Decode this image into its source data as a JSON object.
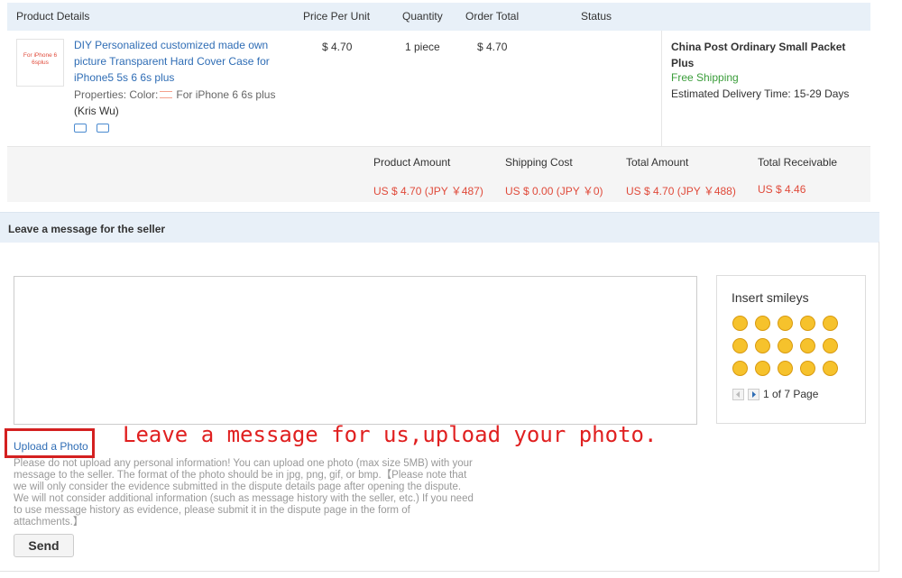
{
  "order_table": {
    "headers": [
      "Product Details",
      "Price Per Unit",
      "Quantity",
      "Order Total",
      "Status"
    ],
    "product": {
      "thumb_text": "For iPhone 6 6splus",
      "title": "DIY Personalized customized made own picture Transparent Hard Cover Case for iPhone5 5s 6 6s plus",
      "properties_label": "Properties: Color:",
      "properties_value": "For iPhone 6 6s plus",
      "properties_extra": "(Kris Wu)",
      "icons": [
        "snapshot-icon",
        "return-icon"
      ]
    },
    "price": "$ 4.70",
    "quantity": "1 piece",
    "order_total": "$ 4.70",
    "shipping": {
      "method": "China Post Ordinary Small Packet Plus",
      "cost_text": "Free Shipping",
      "estimate": "Estimated Delivery Time: 15-29 Days"
    }
  },
  "summary": {
    "labels": [
      "Product Amount",
      "Shipping Cost",
      "Total Amount",
      "Total Receivable"
    ],
    "values": [
      "US $ 4.70 (JPY ￥487)",
      "US $ 0.00 (JPY ￥0)",
      "US $ 4.70 (JPY ￥488)",
      "US $ 4.46"
    ]
  },
  "message": {
    "heading": "Leave a message for the seller",
    "upload_label": "Upload a Photo",
    "annotation": "Leave a message for us,upload your photo.",
    "notice": "Please do not upload any personal information! You can upload one photo (max size 5MB) with your message to the seller. The format of the photo should be in jpg, png, gif, or bmp.【Please note that we will only consider the evidence submitted in the dispute details page after opening the dispute. We will not consider additional information (such as message history with the seller, etc.) If you need to use message history as evidence, please submit it in the dispute page in the form of attachments.】",
    "send_label": "Send"
  },
  "smileys": {
    "title": "Insert smileys",
    "count": 15,
    "page_text": "1 of 7 Page"
  },
  "colors": {
    "link": "#2f6db5",
    "price_red": "#e04a3a",
    "free_green": "#3a9d3a",
    "annotation_red": "#e02020",
    "header_bg": "#e8f0f8"
  }
}
